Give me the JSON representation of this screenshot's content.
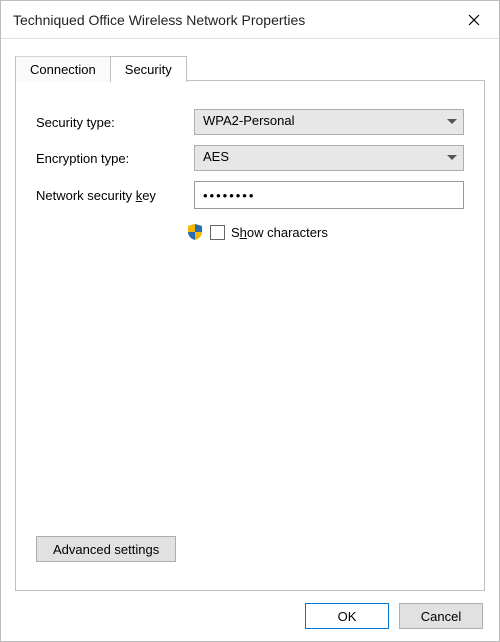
{
  "window": {
    "title": "Techniqued Office Wireless Network Properties"
  },
  "tabs": {
    "connection": "Connection",
    "security": "Security"
  },
  "form": {
    "security_type_label": "Security type:",
    "security_type_value": "WPA2-Personal",
    "encryption_type_label": "Encryption type:",
    "encryption_type_value": "AES",
    "network_key_label_pre": "Network security ",
    "network_key_label_ul": "k",
    "network_key_label_post": "ey",
    "network_key_value": "••••••••",
    "show_characters_pre": "S",
    "show_characters_ul": "h",
    "show_characters_post": "ow characters",
    "show_characters_checked": false
  },
  "buttons": {
    "advanced": "Advanced settings",
    "ok": "OK",
    "cancel": "Cancel"
  },
  "icons": {
    "close": "close-icon",
    "chevron_down": "chevron-down-icon",
    "uac_shield": "uac-shield-icon"
  }
}
